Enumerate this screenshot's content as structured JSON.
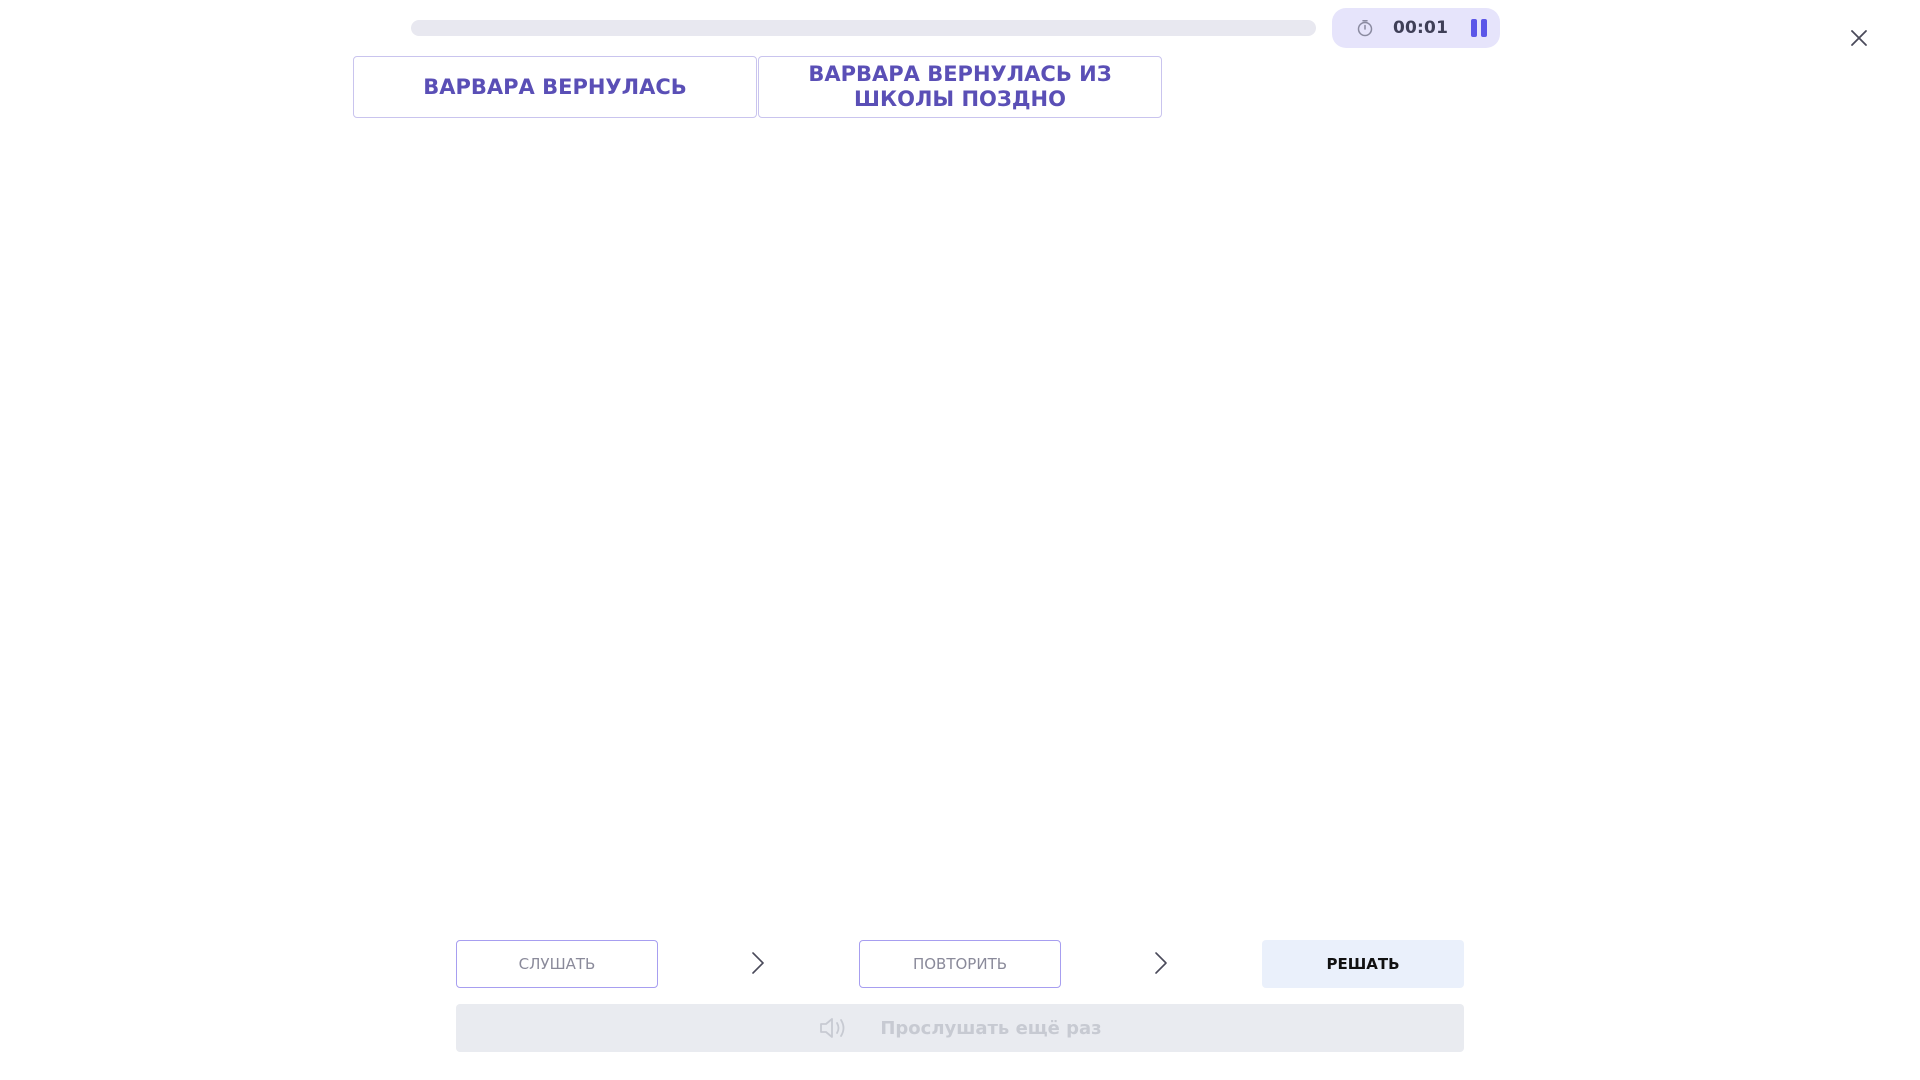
{
  "progress": {
    "value": 0
  },
  "timer": {
    "time": "00:01"
  },
  "cards": [
    {
      "label": "ВАРВАРА ВЕРНУЛАСЬ"
    },
    {
      "label": "ВАРВАРА ВЕРНУЛАСЬ ИЗ ШКОЛЫ ПОЗДНО"
    }
  ],
  "steps": {
    "listen": "СЛУШАТЬ",
    "repeat": "ПОВТОРИТЬ",
    "solve": "РЕШАТЬ"
  },
  "replay": {
    "label": "Прослушать ещё раз"
  },
  "colors": {
    "accent": "#5b56e8",
    "card_text": "#5a4fb6",
    "card_border": "#c9c4ee",
    "timer_bg": "#e6e4fb",
    "solve_bg": "#eaf0fb",
    "replay_bg": "#e9ebf0"
  },
  "icons": {
    "timer": "stopwatch-icon",
    "pause": "pause-icon",
    "close": "close-icon",
    "chevron": "chevron-right-icon",
    "speaker": "speaker-icon"
  }
}
